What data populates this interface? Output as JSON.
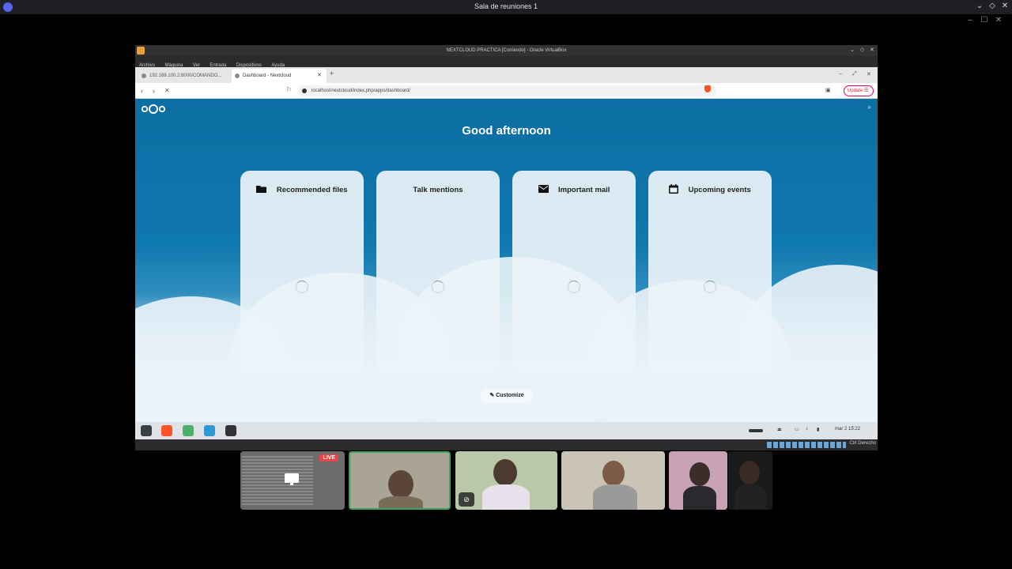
{
  "discord": {
    "title": "Sala de reuniones 1",
    "controls": [
      "⌄",
      "◇",
      "✕"
    ],
    "inner_controls": [
      "–",
      "☐",
      "✕"
    ]
  },
  "vbox": {
    "title": "NEXTCLOUD PRACTICA [Corriendo] - Oracle VirtualBox",
    "menu": [
      "Archivo",
      "Máquina",
      "Ver",
      "Entrada",
      "Dispositivos",
      "Ayuda"
    ],
    "window_controls": [
      "⌄",
      "◇",
      "✕"
    ],
    "status_text": "Ctrl Derecho"
  },
  "browser": {
    "tabs": [
      {
        "label": "192.168.100.2:8000/COMANDO..."
      },
      {
        "label": "Dashboard - Nextcloud"
      }
    ],
    "new_tab": "+",
    "url": "localhost/nextcloud/index.php/apps/dashboard/",
    "update_label": "Update",
    "nav": {
      "back": "‹",
      "forward": "›",
      "stop": "✕"
    }
  },
  "nextcloud": {
    "greeting": "Good afternoon",
    "panels": [
      {
        "title": "Recommended files",
        "icon": "folder-icon"
      },
      {
        "title": "Talk mentions",
        "icon": ""
      },
      {
        "title": "Important mail",
        "icon": "mail-icon"
      },
      {
        "title": "Upcoming events",
        "icon": "calendar-icon"
      }
    ],
    "customize_label": "Customize"
  },
  "vm_taskbar": {
    "clock": "mar 2  15:22"
  },
  "participants": {
    "live_label": "LIVE"
  }
}
